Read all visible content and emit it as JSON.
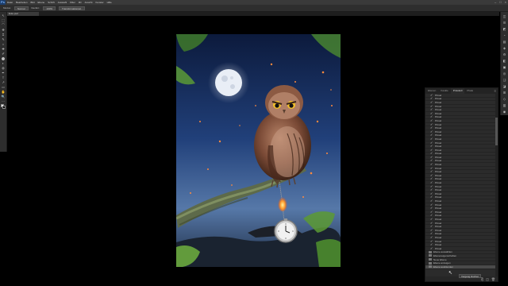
{
  "app": {
    "logo": "Ps"
  },
  "menu": [
    "Datei",
    "Bearbeiten",
    "Bild",
    "Ebene",
    "Schrift",
    "Auswahl",
    "Filter",
    "3D",
    "Ansicht",
    "Fenster",
    "Hilfe"
  ],
  "window_controls": [
    "–",
    "□",
    "×"
  ],
  "options_bar": {
    "mode_label": "Modus:",
    "mode_value": "Normal",
    "deckkraft_label": "Deckkr.:",
    "deckkraft_value": "100%",
    "transform_label": "Transformationsst."
  },
  "document_tab": "Eule.psd",
  "tools": [
    "↖",
    "⬚",
    "⌒",
    "✥",
    "⌗",
    "✎",
    "⌂",
    "✚",
    "✐",
    "⬤",
    "◐",
    "◍",
    "✒",
    "T",
    "↗",
    "▭",
    "✋",
    "🔍",
    "⋯"
  ],
  "right_icons": [
    "◫",
    "☰",
    "◩",
    "◔",
    "▤",
    "◈",
    "⚙",
    "◧",
    "▣",
    "◎",
    "❑",
    "◪",
    "⊞",
    "◇",
    "▥",
    "◉"
  ],
  "panel": {
    "tabs": [
      "Ebenen",
      "Kanäle",
      "Protokoll",
      "Pfade"
    ],
    "active_tab": "Protokoll",
    "menu_icon": "≡",
    "rows": [
      "Pinsel",
      "Pinsel",
      "Pinsel",
      "Pinsel",
      "Pinsel",
      "Pinsel",
      "Pinsel",
      "Pinsel",
      "Pinsel",
      "Pinsel",
      "Pinsel",
      "Pinsel",
      "Pinsel",
      "Pinsel",
      "Pinsel",
      "Pinsel",
      "Pinsel",
      "Pinsel",
      "Pinsel",
      "Pinsel",
      "Pinsel",
      "Pinsel",
      "Pinsel",
      "Pinsel",
      "Pinsel",
      "Pinsel",
      "Pinsel",
      "Pinsel",
      "Pinsel",
      "Pinsel",
      "Pinsel",
      "Pinsel",
      "Pinsel",
      "Pinsel",
      "Pinsel",
      "Pinsel",
      "Pinsel",
      "Pinsel",
      "Pinsel",
      "Pinsel",
      "Pinsel",
      "Pinsel",
      "Pinsel"
    ],
    "bottom_rows": [
      "Ebene auswählen",
      "Ebeneneigenschaften",
      "Neue Ebene",
      "Ebene anzeigen",
      "Ebene ausblenden"
    ],
    "footer_icons": [
      "⎘",
      "◫",
      "🗑"
    ]
  },
  "tooltip": "Vorgang löschen"
}
